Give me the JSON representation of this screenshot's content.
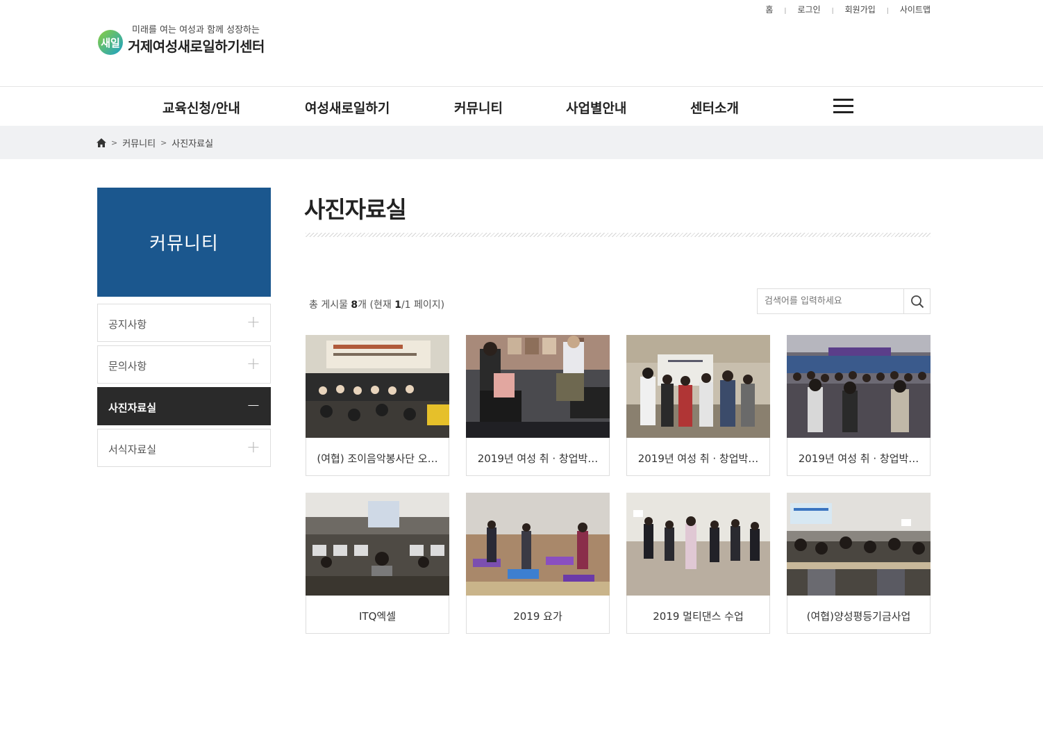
{
  "util_links": [
    "홈",
    "로그인",
    "회원가입",
    "사이트맵"
  ],
  "logo": {
    "slogan": "미래를 여는 여성과 함께 성장하는",
    "mark_text": "새일",
    "name": "거제여성새로일하기센터"
  },
  "gnb": [
    "교육신청/안내",
    "여성새로일하기",
    "커뮤니티",
    "사업별안내",
    "센터소개"
  ],
  "breadcrumb": [
    "커뮤니티",
    "사진자료실"
  ],
  "sidebar": {
    "title": "커뮤니티",
    "items": [
      {
        "label": "공지사항",
        "toggle": "+"
      },
      {
        "label": "문의사항",
        "toggle": "+"
      },
      {
        "label": "사진자료실",
        "toggle": "−"
      },
      {
        "label": "서식자료실",
        "toggle": "+"
      }
    ]
  },
  "main": {
    "title": "사진자료실",
    "count_prefix": "총 게시물 ",
    "count_total": "8",
    "count_unit": "개",
    "page_prefix": "  (현재 ",
    "page_current": "1",
    "page_suffix": "/1 페이지)"
  },
  "search": {
    "placeholder": "검색어를 입력하세요"
  },
  "gallery": [
    {
      "caption": "(여협) 조이음악봉사단 오…"
    },
    {
      "caption": "2019년 여성 취 · 창업박…"
    },
    {
      "caption": "2019년 여성 취 · 창업박…"
    },
    {
      "caption": "2019년 여성 취 · 창업박…"
    },
    {
      "caption": "ITQ엑셀"
    },
    {
      "caption": "2019 요가"
    },
    {
      "caption": "2019 멀티댄스 수업"
    },
    {
      "caption": "(여협)양성평등기금사업"
    }
  ],
  "colors": {
    "accent": "#1b578e",
    "active_menu": "#2a2a2a"
  }
}
